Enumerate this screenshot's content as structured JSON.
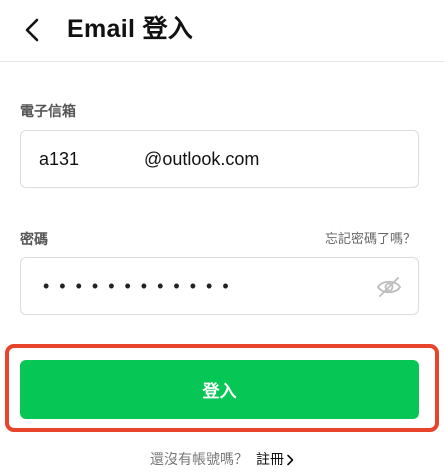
{
  "header": {
    "title": "Email 登入"
  },
  "email": {
    "label": "電子信箱",
    "value": "a131             @outlook.com"
  },
  "password": {
    "label": "密碼",
    "forgot": "忘記密碼了嗎？",
    "masked": "••••••••••••"
  },
  "login_button": {
    "label": "登入"
  },
  "footer": {
    "question": "還沒有帳號嗎？",
    "register": "註冊"
  },
  "colors": {
    "accent": "#06c755",
    "highlight": "#e8432c"
  },
  "icons": [
    "back-arrow-icon",
    "eye-hidden-icon",
    "chevron-right-icon"
  ]
}
